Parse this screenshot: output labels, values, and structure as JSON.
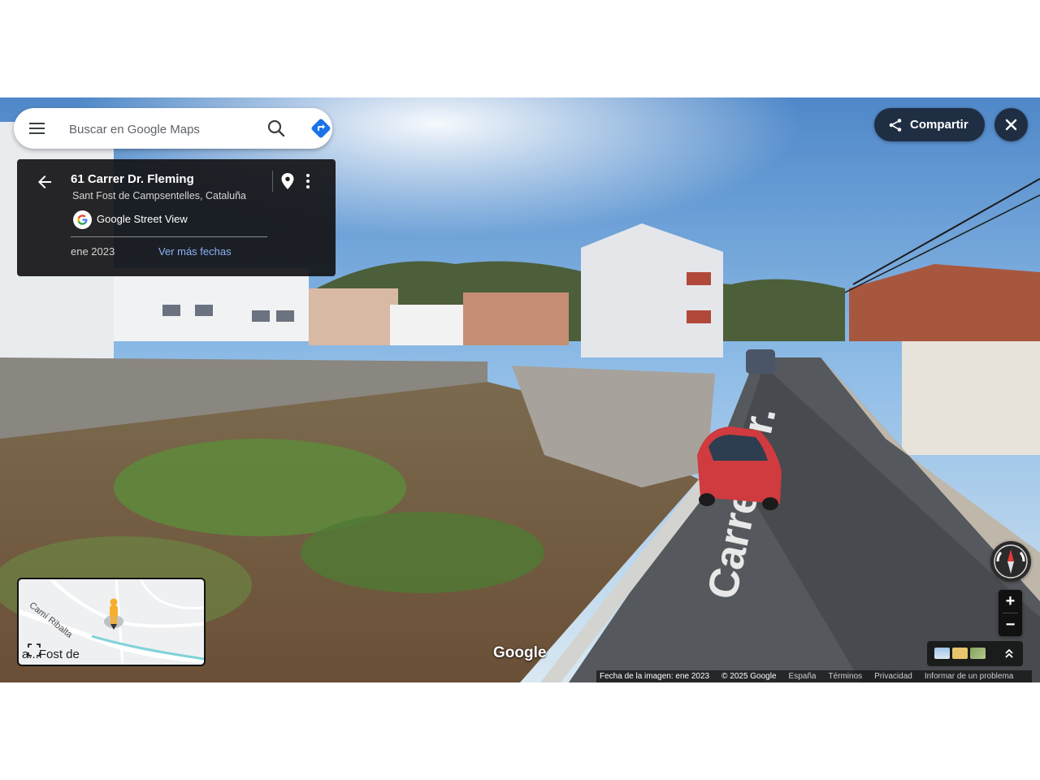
{
  "search": {
    "placeholder": "Buscar en Google Maps"
  },
  "location_card": {
    "title": "61 Carrer Dr. Fleming",
    "subtitle": "Sant Fost de Campsentelles, Cataluña",
    "source_label": "Google Street View",
    "capture_date": "ene 2023",
    "more_dates_label": "Ver más fechas"
  },
  "actions": {
    "share_label": "Compartir"
  },
  "scene": {
    "street_name": "Carrer Dr."
  },
  "minimap": {
    "street_label": "Camí Ribalta",
    "town_label": "a...Fost de"
  },
  "zoom": {
    "in_label": "+",
    "out_label": "−"
  },
  "watermark": "Google",
  "footer": {
    "image_date": "Fecha de la imagen: ene 2023",
    "copyright": "© 2025 Google",
    "country": "España",
    "terms": "Términos",
    "privacy": "Privacidad",
    "report": "Informar de un problema"
  },
  "colors": {
    "accent_blue": "#1a73e8",
    "panel_dark": "#1f2e43",
    "link_blue": "#8ab4f8",
    "sky": "#6aa3d8",
    "grass": "#5f8a3a"
  },
  "icons": {
    "menu": "menu-icon",
    "search": "search-icon",
    "directions": "directions-icon",
    "back": "arrow-back-icon",
    "pin": "location-pin-icon",
    "more": "more-vert-icon",
    "share": "share-icon",
    "close": "close-icon",
    "compass": "compass-icon",
    "pegman": "pegman-icon",
    "expand": "expand-icon"
  }
}
